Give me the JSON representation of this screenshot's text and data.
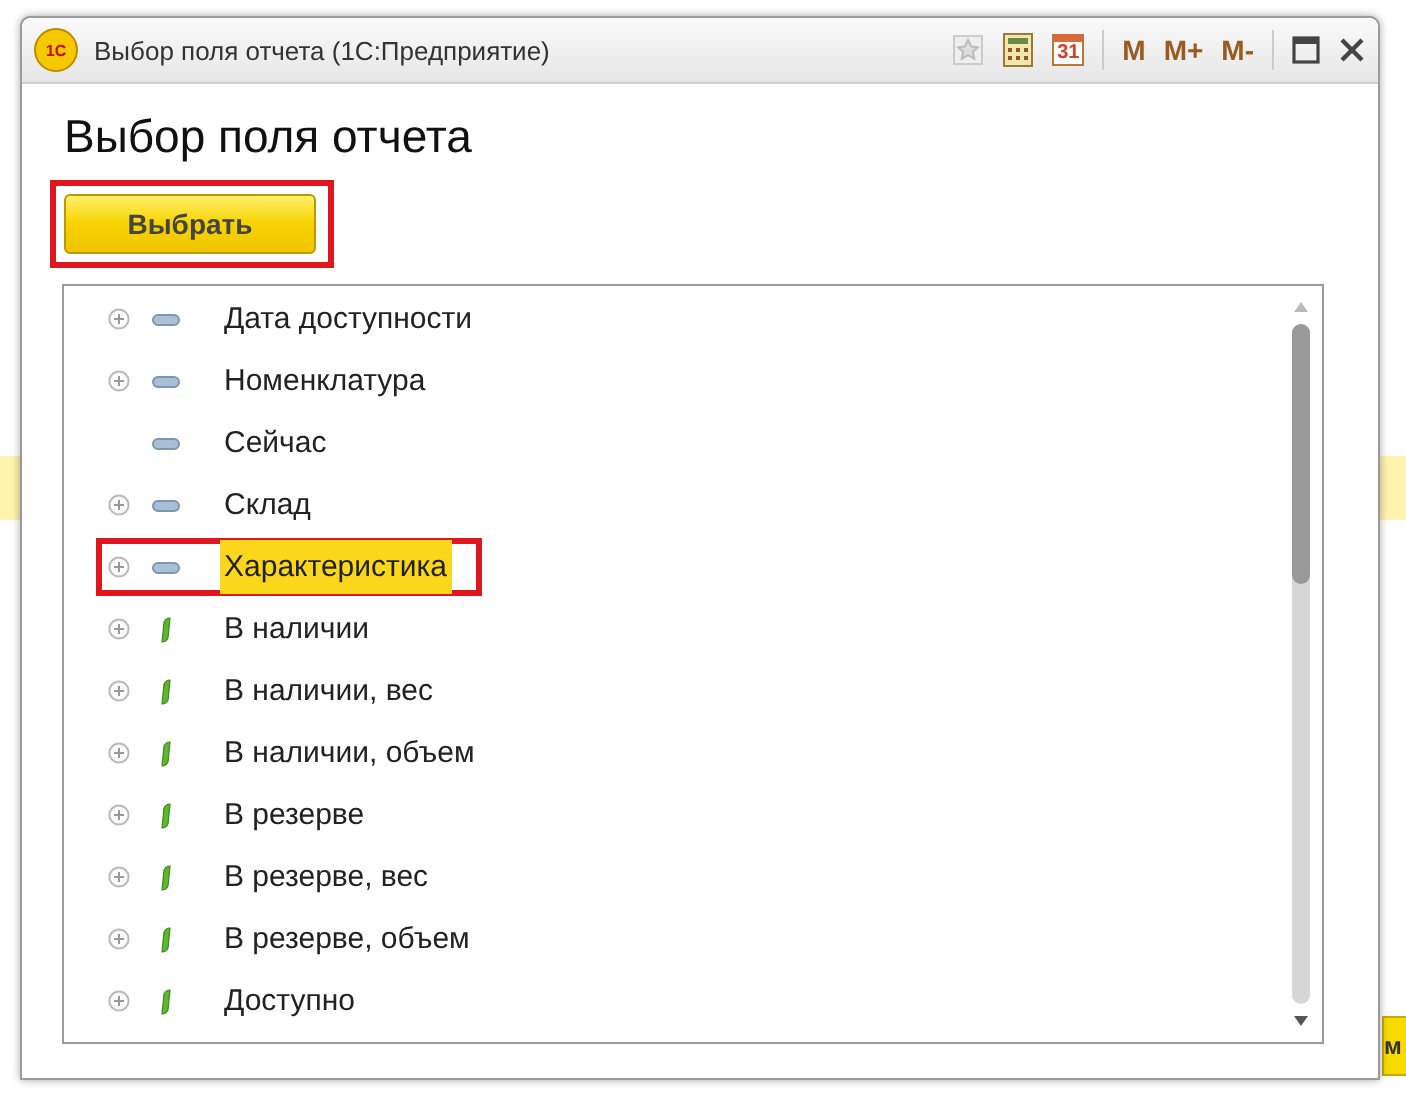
{
  "window": {
    "title": "Выбор поля отчета  (1С:Предприятие)",
    "logo": "1С",
    "calendar_day": "31",
    "memory_buttons": [
      "M",
      "M+",
      "M-"
    ]
  },
  "heading": "Выбор поля отчета",
  "select_button": "Выбрать",
  "fields": [
    {
      "label": "Дата доступности",
      "kind": "dimension",
      "expandable": true,
      "selected": false
    },
    {
      "label": "Номенклатура",
      "kind": "dimension",
      "expandable": true,
      "selected": false
    },
    {
      "label": "Сейчас",
      "kind": "dimension",
      "expandable": false,
      "selected": false
    },
    {
      "label": "Склад",
      "kind": "dimension",
      "expandable": true,
      "selected": false
    },
    {
      "label": "Характеристика",
      "kind": "dimension",
      "expandable": true,
      "selected": true
    },
    {
      "label": "В наличии",
      "kind": "resource",
      "expandable": true,
      "selected": false
    },
    {
      "label": "В наличии, вес",
      "kind": "resource",
      "expandable": true,
      "selected": false
    },
    {
      "label": "В наличии, объем",
      "kind": "resource",
      "expandable": true,
      "selected": false
    },
    {
      "label": "В резерве",
      "kind": "resource",
      "expandable": true,
      "selected": false
    },
    {
      "label": "В резерве, вес",
      "kind": "resource",
      "expandable": true,
      "selected": false
    },
    {
      "label": "В резерве, объем",
      "kind": "resource",
      "expandable": true,
      "selected": false
    },
    {
      "label": "Доступно",
      "kind": "resource",
      "expandable": true,
      "selected": false
    }
  ],
  "background_button": "м"
}
